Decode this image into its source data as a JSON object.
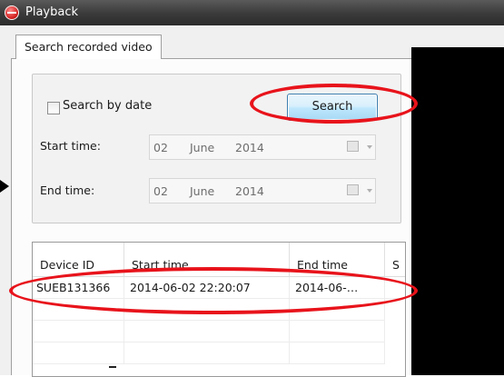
{
  "window": {
    "title": "Playback",
    "icon": "app-record-icon"
  },
  "tabs": [
    {
      "label": "Search recorded video",
      "active": true
    }
  ],
  "search": {
    "by_date_label": "Search by date",
    "by_date_checked": false,
    "button_label": "Search",
    "start_label": "Start time:",
    "end_label": "End time:",
    "start": {
      "day": "02",
      "month": "June",
      "year": "2014"
    },
    "end": {
      "day": "02",
      "month": "June",
      "year": "2014"
    }
  },
  "results": {
    "columns": [
      "Device ID",
      "Start time",
      "End time",
      "S"
    ],
    "rows": [
      [
        "SUEB131366",
        "2014-06-02 22:20:07",
        "2014-06-…",
        ""
      ]
    ]
  },
  "annotation_color": "#e8131b"
}
